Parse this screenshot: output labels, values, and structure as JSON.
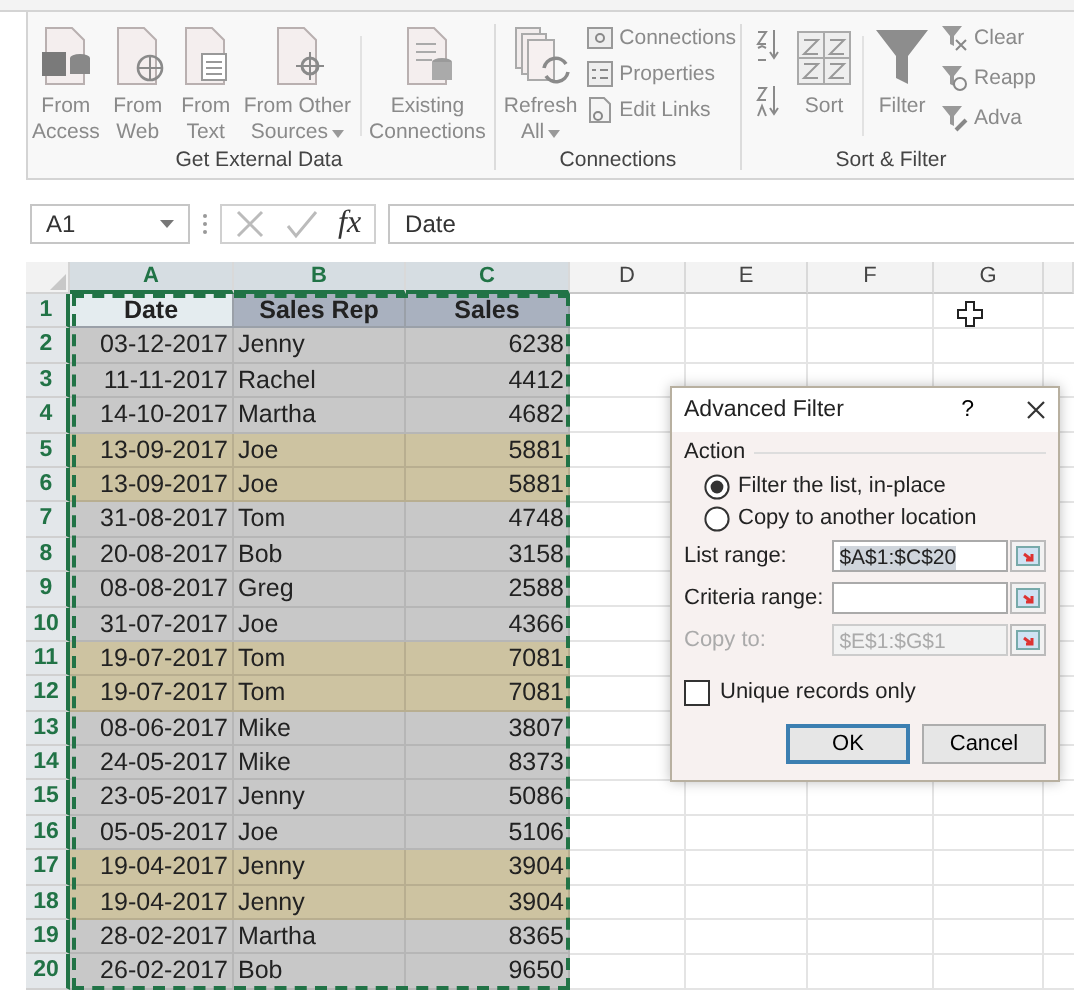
{
  "ribbon": {
    "groups": [
      {
        "label": "Get External Data",
        "items": [
          {
            "lines": [
              "From",
              "Access"
            ],
            "dropdown": false
          },
          {
            "lines": [
              "From",
              "Web"
            ],
            "dropdown": false
          },
          {
            "lines": [
              "From",
              "Text"
            ],
            "dropdown": false
          },
          {
            "lines": [
              "From Other",
              "Sources"
            ],
            "dropdown": true
          },
          {
            "lines": [
              "Existing",
              "Connections"
            ],
            "dropdown": false
          }
        ]
      },
      {
        "label": "Connections",
        "items": [
          {
            "lines": [
              "Refresh",
              "All"
            ],
            "dropdown": true
          }
        ],
        "small": [
          "Connections",
          "Properties",
          "Edit Links"
        ]
      },
      {
        "label": "Sort & Filter",
        "items": [
          {
            "lines": [
              "Sort"
            ],
            "dropdown": false
          },
          {
            "lines": [
              "Filter"
            ],
            "dropdown": false
          }
        ],
        "small": [
          "Clear",
          "Reapp",
          "Adva"
        ]
      }
    ]
  },
  "formula_bar": {
    "name_box": "A1",
    "function_label": "fx",
    "value": "Date"
  },
  "table": {
    "columns": [
      {
        "label": "A",
        "selected": true
      },
      {
        "label": "B",
        "selected": true
      },
      {
        "label": "C",
        "selected": true
      },
      {
        "label": "D",
        "selected": false
      },
      {
        "label": "E",
        "selected": false
      },
      {
        "label": "F",
        "selected": false
      },
      {
        "label": "G",
        "selected": false
      }
    ],
    "header_row": {
      "number": "1",
      "cells": [
        "Date",
        "Sales Rep",
        "Sales"
      ]
    },
    "rows": [
      {
        "number": "2",
        "date": "03-12-2017",
        "rep": "Jenny",
        "sales": "6238",
        "highlighted": false
      },
      {
        "number": "3",
        "date": "11-11-2017",
        "rep": "Rachel",
        "sales": "4412",
        "highlighted": false
      },
      {
        "number": "4",
        "date": "14-10-2017",
        "rep": "Martha",
        "sales": "4682",
        "highlighted": false
      },
      {
        "number": "5",
        "date": "13-09-2017",
        "rep": "Joe",
        "sales": "5881",
        "highlighted": true
      },
      {
        "number": "6",
        "date": "13-09-2017",
        "rep": "Joe",
        "sales": "5881",
        "highlighted": true
      },
      {
        "number": "7",
        "date": "31-08-2017",
        "rep": "Tom",
        "sales": "4748",
        "highlighted": false
      },
      {
        "number": "8",
        "date": "20-08-2017",
        "rep": "Bob",
        "sales": "3158",
        "highlighted": false
      },
      {
        "number": "9",
        "date": "08-08-2017",
        "rep": "Greg",
        "sales": "2588",
        "highlighted": false
      },
      {
        "number": "10",
        "date": "31-07-2017",
        "rep": "Joe",
        "sales": "4366",
        "highlighted": false
      },
      {
        "number": "11",
        "date": "19-07-2017",
        "rep": "Tom",
        "sales": "7081",
        "highlighted": true
      },
      {
        "number": "12",
        "date": "19-07-2017",
        "rep": "Tom",
        "sales": "7081",
        "highlighted": true
      },
      {
        "number": "13",
        "date": "08-06-2017",
        "rep": "Mike",
        "sales": "3807",
        "highlighted": false
      },
      {
        "number": "14",
        "date": "24-05-2017",
        "rep": "Mike",
        "sales": "8373",
        "highlighted": false
      },
      {
        "number": "15",
        "date": "23-05-2017",
        "rep": "Jenny",
        "sales": "5086",
        "highlighted": false
      },
      {
        "number": "16",
        "date": "05-05-2017",
        "rep": "Joe",
        "sales": "5106",
        "highlighted": false
      },
      {
        "number": "17",
        "date": "19-04-2017",
        "rep": "Jenny",
        "sales": "3904",
        "highlighted": true
      },
      {
        "number": "18",
        "date": "19-04-2017",
        "rep": "Jenny",
        "sales": "3904",
        "highlighted": true
      },
      {
        "number": "19",
        "date": "28-02-2017",
        "rep": "Martha",
        "sales": "8365",
        "highlighted": false
      },
      {
        "number": "20",
        "date": "26-02-2017",
        "rep": "Bob",
        "sales": "9650",
        "highlighted": false
      }
    ]
  },
  "dialog": {
    "title": "Advanced Filter",
    "help": "?",
    "section": "Action",
    "options": [
      {
        "label": "Filter the list, in-place",
        "selected": true
      },
      {
        "label": "Copy to another location",
        "selected": false
      }
    ],
    "fields": [
      {
        "label": "List range:",
        "value": "$A$1:$C$20",
        "disabled": false
      },
      {
        "label": "Criteria range:",
        "disabled": false
      },
      {
        "label": "Copy to:",
        "value": "$E$1:$G$1",
        "disabled": true
      }
    ],
    "checkbox": {
      "label": "Unique records only",
      "checked": false
    },
    "buttons": [
      {
        "label": "OK",
        "default": true
      },
      {
        "label": "Cancel",
        "default": false
      }
    ]
  }
}
